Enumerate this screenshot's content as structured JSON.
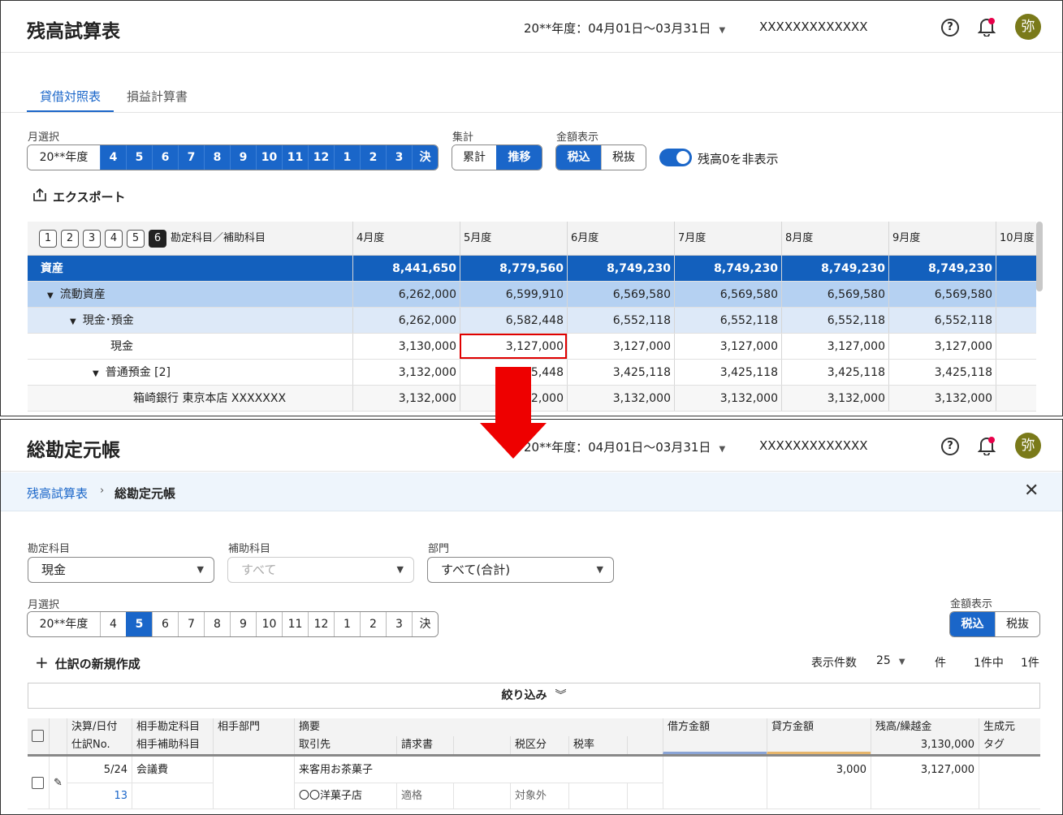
{
  "top": {
    "header": {
      "title": "残高試算表",
      "period": "20**年度：04月01日〜03月31日",
      "company": "XXXXXXXXXXXXX",
      "help": "?",
      "avatar": "弥"
    },
    "tabs": [
      {
        "label": "貸借対照表"
      },
      {
        "label": "損益計算書"
      }
    ],
    "month_label": "月選択",
    "months": [
      "20**年度",
      "4",
      "5",
      "6",
      "7",
      "8",
      "9",
      "10",
      "11",
      "12",
      "1",
      "2",
      "3",
      "決"
    ],
    "agg_label": "集計",
    "agg": [
      "累計",
      "推移"
    ],
    "amount_label": "金額表示",
    "amount": [
      "税込",
      "税抜"
    ],
    "zero_toggle": "残高0を非表示",
    "export": "エクスポート",
    "levels": [
      "1",
      "2",
      "3",
      "4",
      "5",
      "6"
    ],
    "account_col": "勘定科目／補助科目",
    "columns": [
      "4月度",
      "5月度",
      "6月度",
      "7月度",
      "8月度",
      "9月度",
      "10月度"
    ],
    "rows": [
      {
        "name": "資産",
        "values": [
          "8,441,650",
          "8,779,560",
          "8,749,230",
          "8,749,230",
          "8,749,230",
          "8,749,230"
        ]
      },
      {
        "name": "流動資産",
        "values": [
          "6,262,000",
          "6,599,910",
          "6,569,580",
          "6,569,580",
          "6,569,580",
          "6,569,580"
        ]
      },
      {
        "name": "現金･預金",
        "values": [
          "6,262,000",
          "6,582,448",
          "6,552,118",
          "6,552,118",
          "6,552,118",
          "6,552,118"
        ]
      },
      {
        "name": "現金",
        "values": [
          "3,130,000",
          "3,127,000",
          "3,127,000",
          "3,127,000",
          "3,127,000",
          "3,127,000"
        ]
      },
      {
        "name": "普通預金 [2]",
        "values": [
          "3,132,000",
          "3,455,448",
          "3,425,118",
          "3,425,118",
          "3,425,118",
          "3,425,118"
        ]
      },
      {
        "name": "箱崎銀行 東京本店 XXXXXXX",
        "values": [
          "3,132,000",
          "3,132,000",
          "3,132,000",
          "3,132,000",
          "3,132,000",
          "3,132,000"
        ]
      }
    ]
  },
  "bottom": {
    "header": {
      "title": "総勘定元帳",
      "period": "20**年度：04月01日〜03月31日",
      "company": "XXXXXXXXXXXXX",
      "help": "?",
      "avatar": "弥"
    },
    "breadcrumb": {
      "parent": "残高試算表",
      "current": "総勘定元帳"
    },
    "account": {
      "label": "勘定科目",
      "value": "現金"
    },
    "sub_account": {
      "label": "補助科目",
      "value": "すべて"
    },
    "department": {
      "label": "部門",
      "value": "すべて(合計)"
    },
    "month_label": "月選択",
    "months": [
      "20**年度",
      "4",
      "5",
      "6",
      "7",
      "8",
      "9",
      "10",
      "11",
      "12",
      "1",
      "2",
      "3",
      "決"
    ],
    "amount_label": "金額表示",
    "amount": [
      "税込",
      "税抜"
    ],
    "new_entry": "仕訳の新規作成",
    "display_count_label": "表示件数",
    "display_count": "25",
    "unit": "件",
    "count_summary": "1件中",
    "count_total": "1件",
    "filter": "絞り込み",
    "table": {
      "h_date": "決算/日付",
      "h_no": "仕訳No.",
      "h_acct": "相手勘定科目",
      "h_subacct": "相手補助科目",
      "h_dept": "相手部門",
      "h_desc": "摘要",
      "h_client": "取引先",
      "h_invoice": "請求書",
      "h_taxcat": "税区分",
      "h_taxrate": "税率",
      "h_debit": "借方金額",
      "h_credit": "貸方金額",
      "h_balance": "残高/繰越金",
      "h_carry": "3,130,000",
      "h_source": "生成元",
      "h_tag": "タグ",
      "row": {
        "date": "5/24",
        "no": "13",
        "acct": "会議費",
        "desc": "来客用お茶菓子",
        "client": "〇〇洋菓子店",
        "invoice": "適格",
        "taxcat": "対象外",
        "credit": "3,000",
        "balance": "3,127,000"
      }
    }
  },
  "colors": {
    "accent": "#1a66c9",
    "assets_row": "#1360bd",
    "highlight": "#e00000",
    "arrow": "#ee0000"
  }
}
